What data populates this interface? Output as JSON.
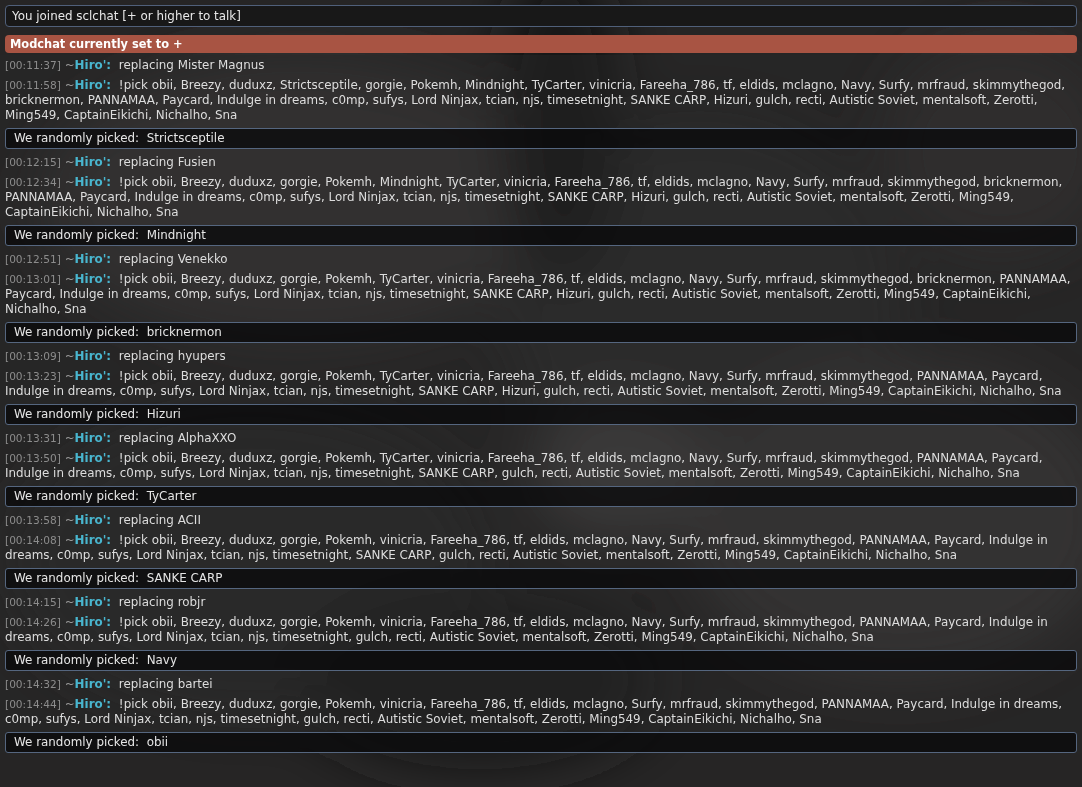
{
  "room_intro": {
    "text": "You joined sclchat [+ or higher to talk]"
  },
  "notice": {
    "text": "Modchat currently set to +"
  },
  "messages": [
    {
      "kind": "chat",
      "time": "[00:11:37]",
      "rank": "~",
      "user": "Hiro':",
      "text": "replacing Mister Magnus"
    },
    {
      "kind": "chat",
      "time": "[00:11:58]",
      "rank": "~",
      "user": "Hiro':",
      "text": "!pick obii, Breezy, duduxz, Strictsceptile, gorgie, Pokemh, Mindnight, TyCarter, vinicria, Fareeha_786, tf, eldids, mclagno, Navy, Surfy, mrfraud, skimmythegod, bricknermon, PANNAMAA, Paycard, Indulge in dreams, c0mp, sufys, Lord Ninjax, tcian, njs, timesetnight, SANKE CARP, Hizuri, gulch, recti, Autistic Soviet, mentalsoft, Zerotti, Ming549, CaptainEikichi, Nichalho, Sna"
    },
    {
      "kind": "pick",
      "text": "We randomly picked:  Strictsceptile"
    },
    {
      "kind": "chat",
      "time": "[00:12:15]",
      "rank": "~",
      "user": "Hiro':",
      "text": "replacing Fusien"
    },
    {
      "kind": "chat",
      "time": "[00:12:34]",
      "rank": "~",
      "user": "Hiro':",
      "text": "!pick obii, Breezy, duduxz, gorgie, Pokemh, Mindnight, TyCarter, vinicria, Fareeha_786, tf, eldids, mclagno, Navy, Surfy, mrfraud, skimmythegod, bricknermon, PANNAMAA, Paycard, Indulge in dreams, c0mp, sufys, Lord Ninjax, tcian, njs, timesetnight, SANKE CARP, Hizuri, gulch, recti, Autistic Soviet, mentalsoft, Zerotti, Ming549, CaptainEikichi, Nichalho, Sna"
    },
    {
      "kind": "pick",
      "text": "We randomly picked:  Mindnight"
    },
    {
      "kind": "chat",
      "time": "[00:12:51]",
      "rank": "~",
      "user": "Hiro':",
      "text": "replacing Venekko"
    },
    {
      "kind": "chat",
      "time": "[00:13:01]",
      "rank": "~",
      "user": "Hiro':",
      "text": "!pick obii, Breezy, duduxz, gorgie, Pokemh, TyCarter, vinicria, Fareeha_786, tf, eldids, mclagno, Navy, Surfy, mrfraud, skimmythegod, bricknermon, PANNAMAA, Paycard, Indulge in dreams, c0mp, sufys, Lord Ninjax, tcian, njs, timesetnight, SANKE CARP, Hizuri, gulch, recti, Autistic Soviet, mentalsoft, Zerotti, Ming549, CaptainEikichi, Nichalho, Sna"
    },
    {
      "kind": "pick",
      "text": "We randomly picked:  bricknermon"
    },
    {
      "kind": "chat",
      "time": "[00:13:09]",
      "rank": "~",
      "user": "Hiro':",
      "text": "replacing hyupers"
    },
    {
      "kind": "chat",
      "time": "[00:13:23]",
      "rank": "~",
      "user": "Hiro':",
      "text": "!pick obii, Breezy, duduxz, gorgie, Pokemh, TyCarter, vinicria, Fareeha_786, tf, eldids, mclagno, Navy, Surfy, mrfraud, skimmythegod, PANNAMAA, Paycard, Indulge in dreams, c0mp, sufys, Lord Ninjax, tcian, njs, timesetnight, SANKE CARP, Hizuri, gulch, recti, Autistic Soviet, mentalsoft, Zerotti, Ming549, CaptainEikichi, Nichalho, Sna"
    },
    {
      "kind": "pick",
      "text": "We randomly picked:  Hizuri"
    },
    {
      "kind": "chat",
      "time": "[00:13:31]",
      "rank": "~",
      "user": "Hiro':",
      "text": "replacing AlphaXXO"
    },
    {
      "kind": "chat",
      "time": "[00:13:50]",
      "rank": "~",
      "user": "Hiro':",
      "text": "!pick obii, Breezy, duduxz, gorgie, Pokemh, TyCarter, vinicria, Fareeha_786, tf, eldids, mclagno, Navy, Surfy, mrfraud, skimmythegod, PANNAMAA, Paycard, Indulge in dreams, c0mp, sufys, Lord Ninjax, tcian, njs, timesetnight, SANKE CARP, gulch, recti, Autistic Soviet, mentalsoft, Zerotti, Ming549, CaptainEikichi, Nichalho, Sna"
    },
    {
      "kind": "pick",
      "text": "We randomly picked:  TyCarter"
    },
    {
      "kind": "chat",
      "time": "[00:13:58]",
      "rank": "~",
      "user": "Hiro':",
      "text": "replacing ACII"
    },
    {
      "kind": "chat",
      "time": "[00:14:08]",
      "rank": "~",
      "user": "Hiro':",
      "text": "!pick obii, Breezy, duduxz, gorgie, Pokemh, vinicria, Fareeha_786, tf, eldids, mclagno, Navy, Surfy, mrfraud, skimmythegod, PANNAMAA, Paycard, Indulge in dreams, c0mp, sufys, Lord Ninjax, tcian, njs, timesetnight, SANKE CARP, gulch, recti, Autistic Soviet, mentalsoft, Zerotti, Ming549, CaptainEikichi, Nichalho, Sna"
    },
    {
      "kind": "pick",
      "text": "We randomly picked:  SANKE CARP"
    },
    {
      "kind": "chat",
      "time": "[00:14:15]",
      "rank": "~",
      "user": "Hiro':",
      "text": "replacing robjr"
    },
    {
      "kind": "chat",
      "time": "[00:14:26]",
      "rank": "~",
      "user": "Hiro':",
      "text": "!pick obii, Breezy, duduxz, gorgie, Pokemh, vinicria, Fareeha_786, tf, eldids, mclagno, Navy, Surfy, mrfraud, skimmythegod, PANNAMAA, Paycard, Indulge in dreams, c0mp, sufys, Lord Ninjax, tcian, njs, timesetnight, gulch, recti, Autistic Soviet, mentalsoft, Zerotti, Ming549, CaptainEikichi, Nichalho, Sna"
    },
    {
      "kind": "pick",
      "text": "We randomly picked:  Navy"
    },
    {
      "kind": "chat",
      "time": "[00:14:32]",
      "rank": "~",
      "user": "Hiro':",
      "text": "replacing bartei"
    },
    {
      "kind": "chat",
      "time": "[00:14:44]",
      "rank": "~",
      "user": "Hiro':",
      "text": "!pick obii, Breezy, duduxz, gorgie, Pokemh, vinicria, Fareeha_786, tf, eldids, mclagno, Surfy, mrfraud, skimmythegod, PANNAMAA, Paycard, Indulge in dreams, c0mp, sufys, Lord Ninjax, tcian, njs, timesetnight, gulch, recti, Autistic Soviet, mentalsoft, Zerotti, Ming549, CaptainEikichi, Nichalho, Sna"
    },
    {
      "kind": "pick",
      "text": "We randomly picked:  obii"
    }
  ]
}
